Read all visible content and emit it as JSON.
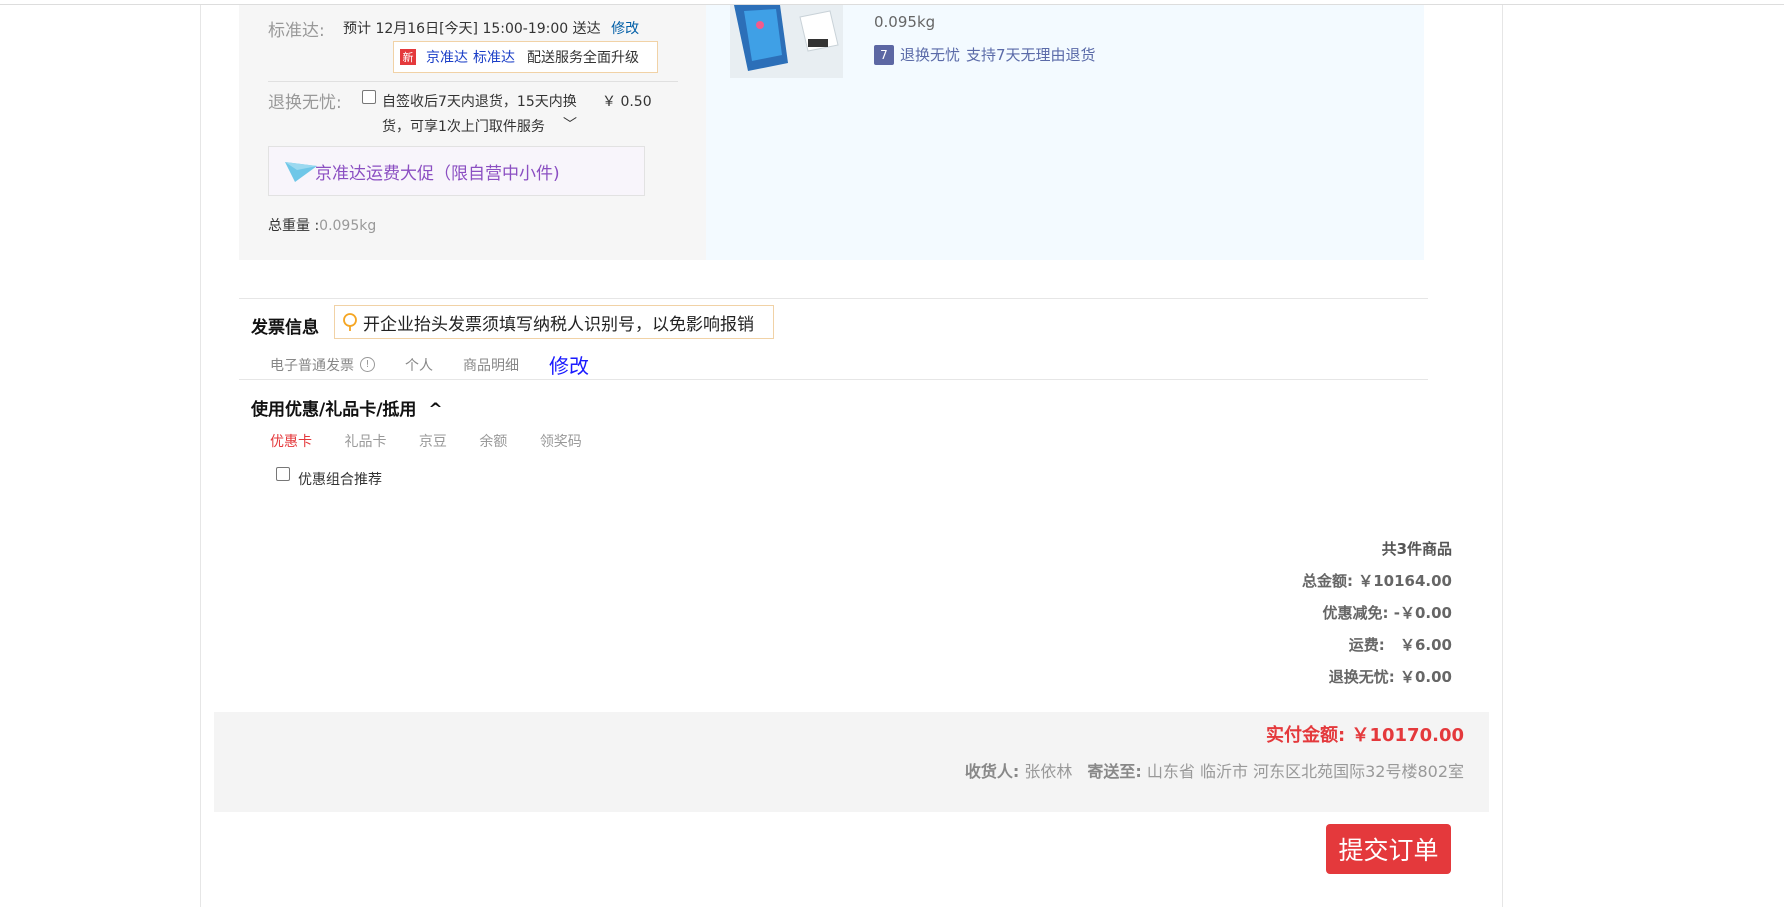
{
  "delivery": {
    "standard_label": "标准达:",
    "standard_estimate": "预计 12月16日[今天] 15:00-19:00 送达",
    "modify_link": "修改",
    "badge_new": "新",
    "promo_jzd": "京准达",
    "promo_bzd": "标准达",
    "promo_text": "配送服务全面升级",
    "return_label": "退换无忧:",
    "return_desc_line1": "自签收后7天内退货，15天内换",
    "return_price": "￥ 0.50",
    "return_desc_line2": "货，可享1次上门取件服务",
    "return_chevron": "﹀",
    "jzd_promo_banner": "京准达运费大促（限自营中小件)",
    "total_weight_label": "总重量 :",
    "total_weight_value": "0.095kg"
  },
  "product": {
    "weight": "0.095kg",
    "service_icon_text": "7",
    "service_name": "退换无忧",
    "service_desc": "支持7天无理由退货"
  },
  "invoice": {
    "title": "发票信息",
    "tip": "开企业抬头发票须填写纳税人识别号，以免影响报销",
    "type": "电子普通发票",
    "info_icon": "!",
    "holder": "个人",
    "content": "商品明细",
    "modify": "修改"
  },
  "coupons": {
    "title": "使用优惠/礼品卡/抵用",
    "toggle": "^",
    "tabs": [
      "优惠卡",
      "礼品卡",
      "京豆",
      "余额",
      "领奖码"
    ],
    "combo_label": "优惠组合推荐"
  },
  "summary": {
    "count": "共3件商品",
    "total_label": "总金额:",
    "total_value": "￥10164.00",
    "discount_label": "优惠减免:",
    "discount_value": "-￥0.00",
    "shipping_label": "运费:",
    "shipping_value": "￥6.00",
    "return_label": "退换无忧:",
    "return_value": "￥0.00"
  },
  "payment": {
    "actual_label": "实付金额:",
    "actual_value": "￥10170.00",
    "receiver_label": "收货人:",
    "receiver_name": "张依林",
    "address_label": "寄送至:",
    "address": "山东省 临沂市 河东区北苑国际32号楼802室"
  },
  "submit_label": "提交订单",
  "colors": {
    "accent_red": "#e4393c",
    "link_blue": "#005ea7",
    "purple": "#8b4fc2"
  }
}
